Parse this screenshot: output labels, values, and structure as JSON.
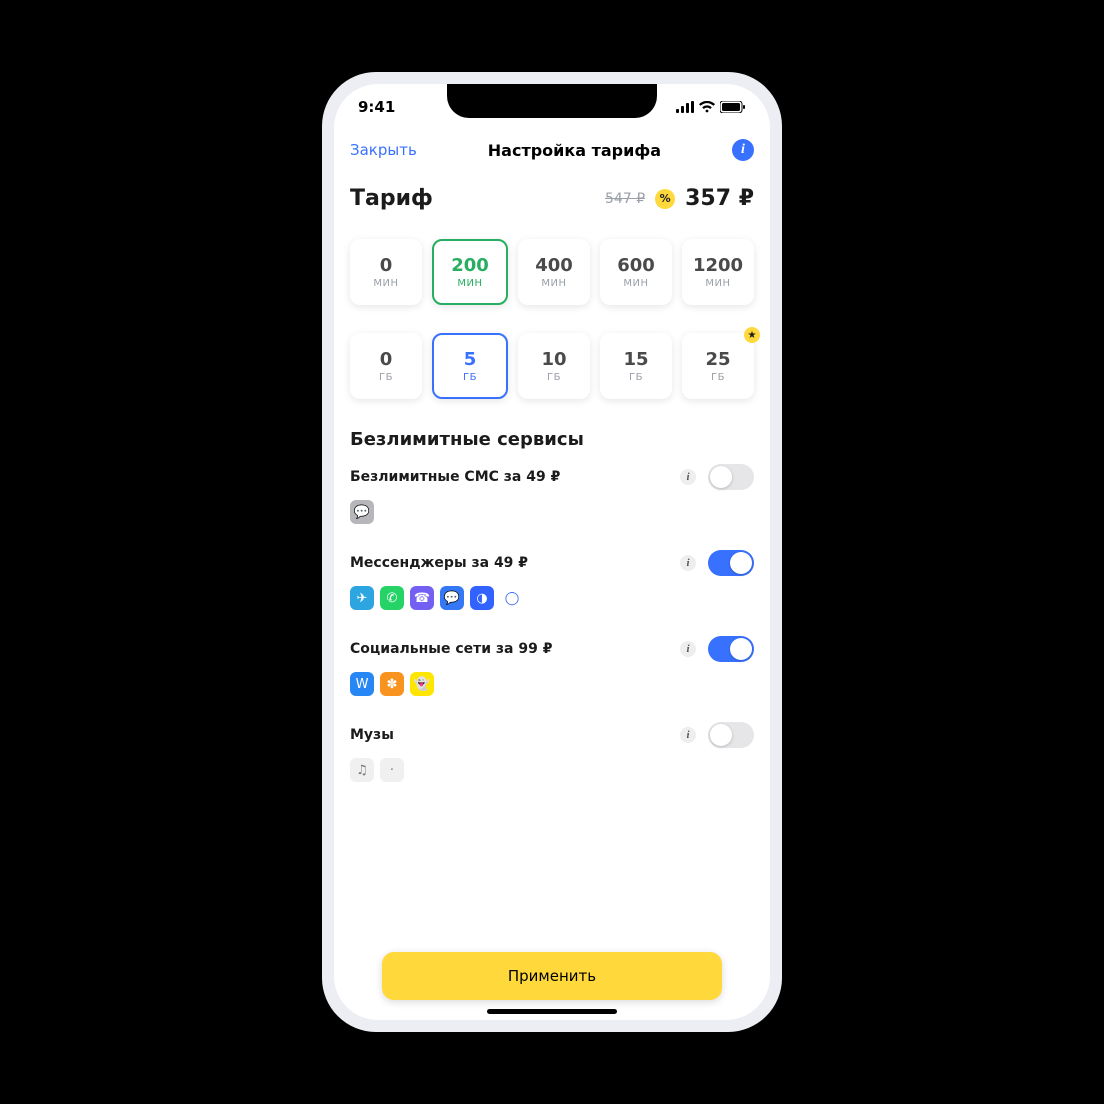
{
  "status": {
    "time": "9:41"
  },
  "nav": {
    "close": "Закрыть",
    "title": "Настройка тарифа"
  },
  "price": {
    "label": "Тариф",
    "old": "547 ₽",
    "discount": "%",
    "new": "357 ₽"
  },
  "minutes": {
    "unit": "МИН",
    "options": [
      "0",
      "200",
      "400",
      "600",
      "1200"
    ],
    "selected_index": 1
  },
  "gb": {
    "unit": "ГБ",
    "options": [
      "0",
      "5",
      "10",
      "15",
      "25"
    ],
    "selected_index": 1,
    "star_index": 4
  },
  "section_unlimited": "Безлимитные сервисы",
  "services": [
    {
      "label": "Безлимитные СМС за  49 ₽",
      "on": false,
      "icons": [
        {
          "name": "sms-icon",
          "bg": "#b7b7bb",
          "glyph": "💬"
        }
      ]
    },
    {
      "label": "Мессенджеры за  49 ₽",
      "on": true,
      "icons": [
        {
          "name": "telegram-icon",
          "bg": "#2ca5e0",
          "glyph": "✈"
        },
        {
          "name": "whatsapp-icon",
          "bg": "#25d366",
          "glyph": "✆"
        },
        {
          "name": "viber-icon",
          "bg": "#7360f2",
          "glyph": "☎"
        },
        {
          "name": "imessage-icon",
          "bg": "#3478f6",
          "glyph": "💬"
        },
        {
          "name": "chat-icon",
          "bg": "#3262ff",
          "glyph": "◑"
        },
        {
          "name": "line-icon",
          "bg": "#fff",
          "glyph": "◯",
          "fg": "#3262ff"
        }
      ]
    },
    {
      "label": "Социальные сети за  99 ₽",
      "on": true,
      "icons": [
        {
          "name": "vk-icon",
          "bg": "#2787f5",
          "glyph": "W"
        },
        {
          "name": "ok-icon",
          "bg": "#f7931e",
          "glyph": "✽"
        },
        {
          "name": "snapchat-icon",
          "bg": "#ffe600",
          "glyph": "👻",
          "fg": "#000"
        }
      ]
    },
    {
      "label": "Музы",
      "on": false,
      "icons": [
        {
          "name": "music-icon",
          "bg": "#f0f0f0",
          "glyph": "♫",
          "fg": "#7a7a7a"
        },
        {
          "name": "music2-icon",
          "bg": "#f0f0f0",
          "glyph": "·",
          "fg": "#7a7a7a"
        }
      ]
    }
  ],
  "apply": "Применить"
}
